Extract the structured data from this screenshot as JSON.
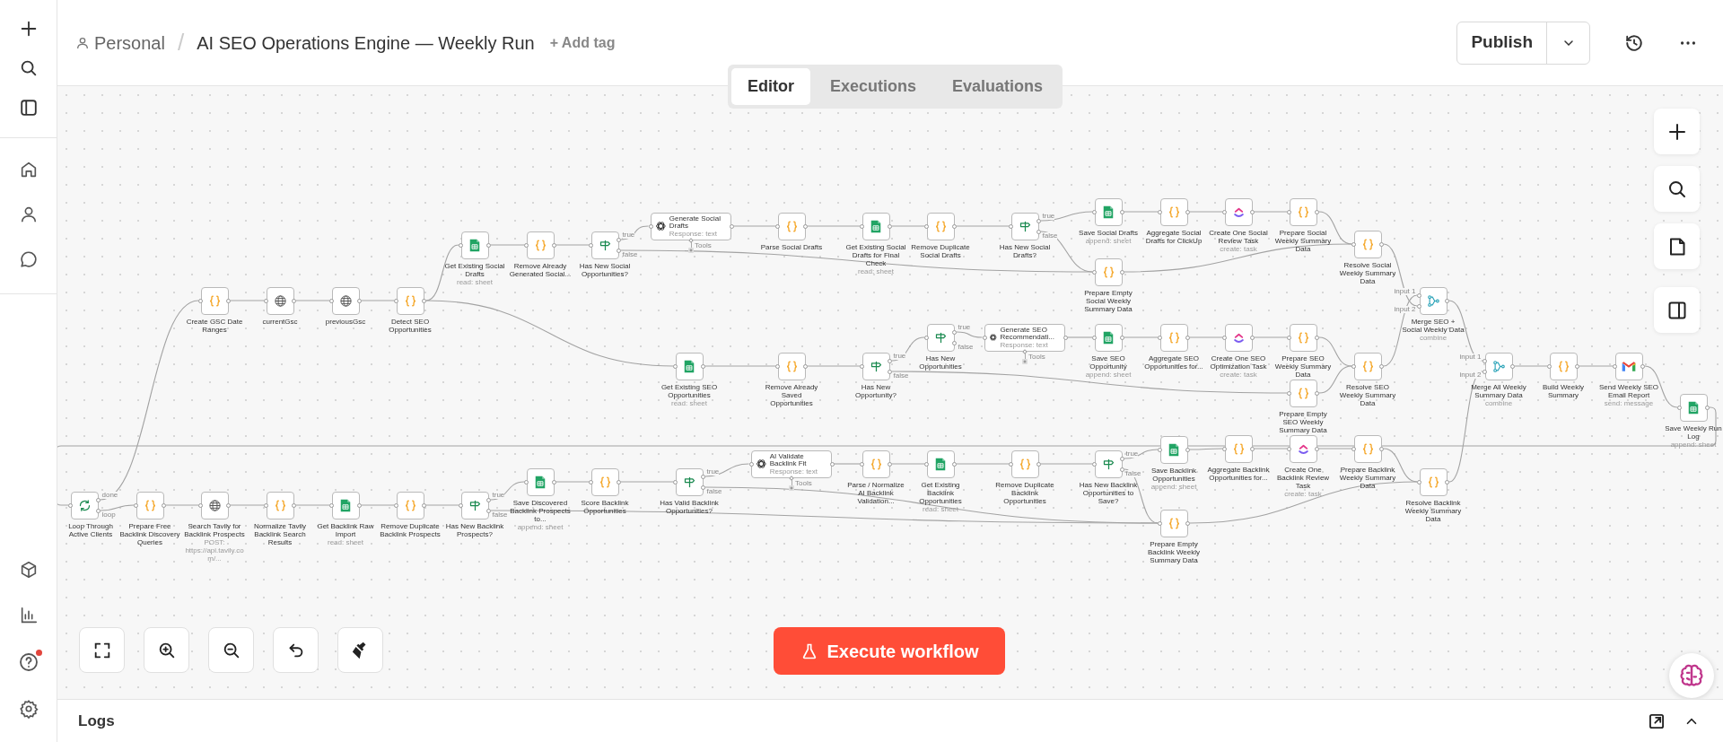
{
  "header": {
    "breadcrumb": "Personal",
    "separator": "/",
    "title": "AI SEO Operations Engine — Weekly Run",
    "add_tag": "+ Add tag",
    "publish": "Publish"
  },
  "tabs": [
    {
      "label": "Editor",
      "selected": true
    },
    {
      "label": "Executions",
      "selected": false
    },
    {
      "label": "Evaluations",
      "selected": false
    }
  ],
  "canvas": {
    "nodes": [
      {
        "kind": "loop",
        "label": "Loop Through Active Clients",
        "outputs": [
          "done",
          "loop"
        ]
      },
      {
        "kind": "code",
        "label": "Create GSC Date Ranges"
      },
      {
        "kind": "http",
        "label": "currentGsc"
      },
      {
        "kind": "http",
        "label": "previousGsc"
      },
      {
        "kind": "code",
        "label": "Detect SEO Opportunities"
      },
      {
        "kind": "sheets",
        "label": "Get Existing Social Drafts",
        "subtitle": "read: sheet"
      },
      {
        "kind": "code",
        "label": "Remove Already Generated Social..."
      },
      {
        "kind": "if",
        "label": "Has New Social Opportunities?",
        "outputs": [
          "true",
          "false"
        ]
      },
      {
        "kind": "ai",
        "label": "Generate Social Drafts",
        "subtitle": "Response: text",
        "tool_port": "Tools"
      },
      {
        "kind": "code",
        "label": "Parse Social Drafts"
      },
      {
        "kind": "sheets",
        "label": "Get Existing Social Drafts for Final Check",
        "subtitle": "read: sheet"
      },
      {
        "kind": "code",
        "label": "Remove Duplicate Social Drafts"
      },
      {
        "kind": "if",
        "label": "Has New Social Drafts?",
        "outputs": [
          "true",
          "false"
        ]
      },
      {
        "kind": "sheets",
        "label": "Save Social Drafts",
        "subtitle": "append: sheet"
      },
      {
        "kind": "code",
        "label": "Aggregate Social Drafts for ClickUp"
      },
      {
        "kind": "clickup",
        "label": "Create One Social Review Task",
        "subtitle": "create: task"
      },
      {
        "kind": "code",
        "label": "Prepare Social Weekly Summary Data"
      },
      {
        "kind": "code",
        "label": "Prepare Empty Social Weekly Summary Data"
      },
      {
        "kind": "code",
        "label": "Resolve Social Weekly Summary Data"
      },
      {
        "kind": "sheets",
        "label": "Get Existing SEO Opportunities",
        "subtitle": "read: sheet"
      },
      {
        "kind": "code",
        "label": "Remove Already Saved Opportunities"
      },
      {
        "kind": "if",
        "label": "Has New Opportunity?",
        "outputs": [
          "true",
          "false"
        ]
      },
      {
        "kind": "if",
        "label": "Has New Opportunities",
        "outputs": [
          "true",
          "false"
        ]
      },
      {
        "kind": "ai",
        "label": "Generate SEO Recommendati...",
        "subtitle": "Response: text",
        "tool_port": "Tools"
      },
      {
        "kind": "sheets",
        "label": "Save SEO Opportunity",
        "subtitle": "append: sheet"
      },
      {
        "kind": "code",
        "label": "Aggregate SEO Opportunities for..."
      },
      {
        "kind": "clickup",
        "label": "Create One SEO Optimization Task",
        "subtitle": "create: task"
      },
      {
        "kind": "code",
        "label": "Prepare SEO Weekly Summary Data"
      },
      {
        "kind": "code",
        "label": "Prepare Empty SEO Weekly Summary Data"
      },
      {
        "kind": "code",
        "label": "Resolve SEO Weekly Summary Data"
      },
      {
        "kind": "merge",
        "label": "Merge SEO + Social Weekly Data",
        "subtitle": "combine",
        "inputs": [
          "input 1",
          "input 2"
        ]
      },
      {
        "kind": "merge",
        "label": "Merge All Weekly Summary Data",
        "subtitle": "combine",
        "inputs": [
          "input 1",
          "input 2"
        ]
      },
      {
        "kind": "code",
        "label": "Build Weekly Summary"
      },
      {
        "kind": "gmail",
        "label": "Send Weekly SEO Email Report",
        "subtitle": "send: message"
      },
      {
        "kind": "sheets",
        "label": "Save Weekly Run Log",
        "subtitle": "append: sheet"
      },
      {
        "kind": "code",
        "label": "Prepare Free Backlink Discovery Queries"
      },
      {
        "kind": "http",
        "label": "Search Tavily for Backlink Prospects",
        "subtitle": "POST: https://api.tavily.com/..."
      },
      {
        "kind": "code",
        "label": "Normalize Tavily Backlink Search Results"
      },
      {
        "kind": "sheets",
        "label": "Get Backlink Raw Import",
        "subtitle": "read: sheet"
      },
      {
        "kind": "code",
        "label": "Remove Duplicate Backlink Prospects"
      },
      {
        "kind": "if",
        "label": "Has New Backlink Prospects?",
        "outputs": [
          "true",
          "false"
        ]
      },
      {
        "kind": "sheets",
        "label": "Save Discovered Backlink Prospects to...",
        "subtitle": "append: sheet"
      },
      {
        "kind": "code",
        "label": "Score Backlink Opportunities"
      },
      {
        "kind": "if",
        "label": "Has Valid Backlink Opportunities?",
        "outputs": [
          "true",
          "false"
        ]
      },
      {
        "kind": "ai",
        "label": "AI Validate Backlink Fit",
        "subtitle": "Response: text",
        "tool_port": "Tools"
      },
      {
        "kind": "code",
        "label": "Parse / Normalize AI Backlink Validation..."
      },
      {
        "kind": "sheets",
        "label": "Get Existing Backlink Opportunities",
        "subtitle": "read: sheet"
      },
      {
        "kind": "code",
        "label": "Remove Duplicate Backlink Opportunities"
      },
      {
        "kind": "if",
        "label": "Has New Backlink Opportunities to Save?",
        "outputs": [
          "true",
          "false"
        ]
      },
      {
        "kind": "sheets",
        "label": "Save Backlink Opportunities",
        "subtitle": "append: sheet"
      },
      {
        "kind": "code",
        "label": "Aggregate Backlink Opportunities for..."
      },
      {
        "kind": "clickup",
        "label": "Create One Backlink Review Task",
        "subtitle": "create: task"
      },
      {
        "kind": "code",
        "label": "Prepare Backlink Weekly Summary Data"
      },
      {
        "kind": "code",
        "label": "Prepare Empty Backlink Weekly Summary Data"
      },
      {
        "kind": "code",
        "label": "Resolve Backlink Weekly Summary Data"
      }
    ]
  },
  "execute_button": "Execute workflow",
  "logs": {
    "label": "Logs"
  }
}
